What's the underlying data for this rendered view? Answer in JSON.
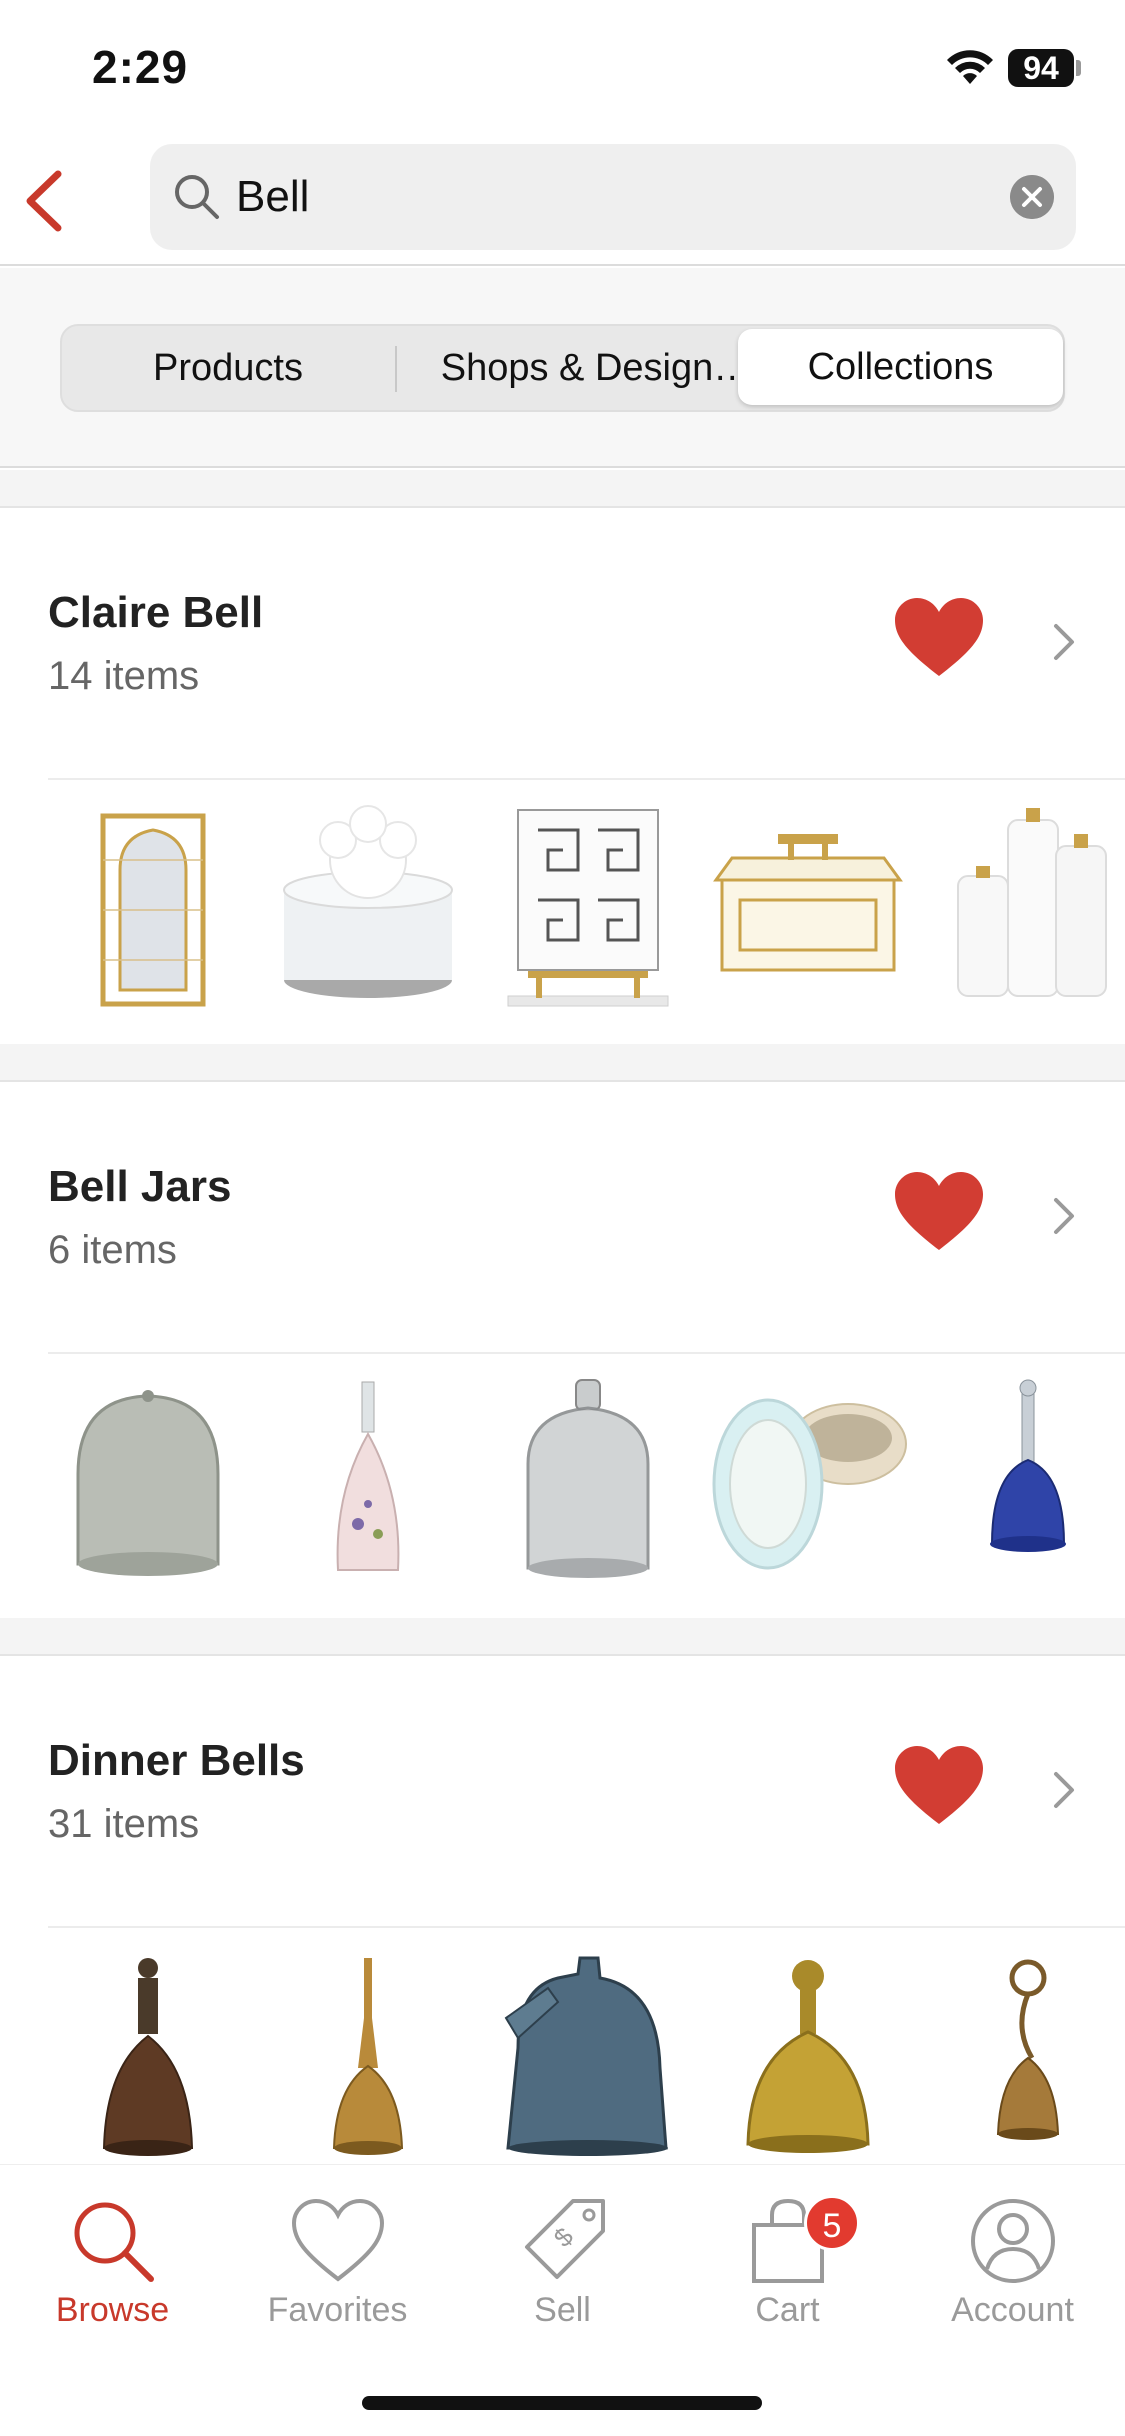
{
  "status_bar": {
    "time": "2:29",
    "battery": "94"
  },
  "search": {
    "value": "Bell",
    "placeholder": "Search"
  },
  "segments": [
    "Products",
    "Shops & Design…",
    "Collections"
  ],
  "collections": [
    {
      "title": "Claire Bell",
      "count": "14 items",
      "favorited": true
    },
    {
      "title": "Bell Jars",
      "count": "6 items",
      "favorited": true
    },
    {
      "title": "Dinner Bells",
      "count": "31 items",
      "favorited": true
    }
  ],
  "tabs": {
    "browse": "Browse",
    "favorites": "Favorites",
    "sell": "Sell",
    "cart": "Cart",
    "cart_badge": "5",
    "account": "Account"
  },
  "colors": {
    "accent": "#c8392b",
    "heart": "#d23d33",
    "badge": "#e23a2f"
  }
}
